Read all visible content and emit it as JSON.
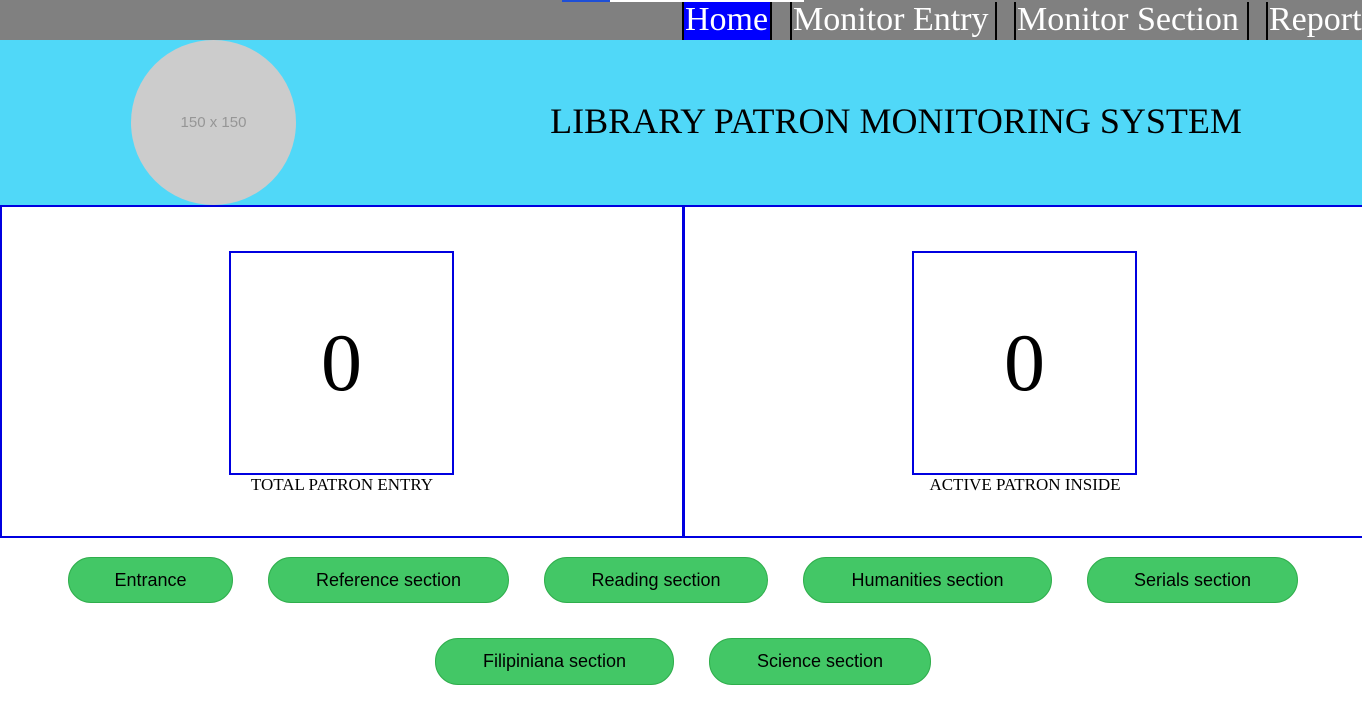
{
  "nav": {
    "items": [
      {
        "label": "Home"
      },
      {
        "label": "Monitor Entry"
      },
      {
        "label": "Monitor Section"
      },
      {
        "label": "Report"
      }
    ]
  },
  "header": {
    "logo_placeholder": "150 x 150",
    "title": "LIBRARY PATRON MONITORING SYSTEM"
  },
  "stats": [
    {
      "value": "0",
      "label": "TOTAL PATRON ENTRY"
    },
    {
      "value": "0",
      "label": "ACTIVE PATRON INSIDE"
    }
  ],
  "sections": [
    {
      "label": "Entrance"
    },
    {
      "label": "Reference section"
    },
    {
      "label": "Reading section"
    },
    {
      "label": "Humanities section"
    },
    {
      "label": "Serials section"
    },
    {
      "label": "Filipiniana section"
    },
    {
      "label": "Science section"
    }
  ],
  "colors": {
    "topbar": "#808080",
    "nav_active": "#0000ff",
    "header": "#50d8f8",
    "panel_border": "#0000e0",
    "button": "#43c766"
  }
}
